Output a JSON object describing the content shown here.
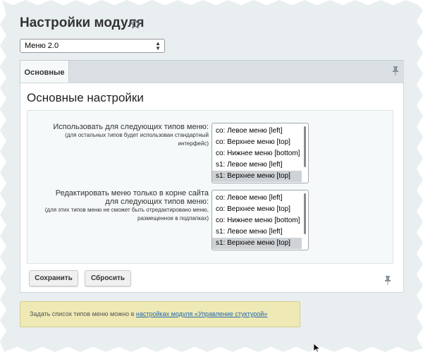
{
  "page": {
    "title": "Настройки модуля"
  },
  "module_select": {
    "value": "Меню 2.0"
  },
  "tabs": [
    {
      "label": "Основные",
      "active": true
    }
  ],
  "section": {
    "title": "Основные настройки"
  },
  "fields": [
    {
      "label": "Использовать для следующих типов меню:",
      "hint": "(для остальных типов будет использован стандартный интерфейс)",
      "options": [
        {
          "label": "co: Левое меню [left]",
          "selected": false
        },
        {
          "label": "co: Верхнее меню [top]",
          "selected": false
        },
        {
          "label": "co: Нижнее меню [bottom]",
          "selected": false
        },
        {
          "label": "s1: Левое меню [left]",
          "selected": false
        },
        {
          "label": "s1: Верхнее меню [top]",
          "selected": true
        }
      ]
    },
    {
      "label": "Редактировать меню только в корне сайта для следующих типов меню:",
      "hint": "(для этих типов меню не сможет быть отредактировано меню, размещенное в подпапках)",
      "options": [
        {
          "label": "co: Левое меню [left]",
          "selected": false
        },
        {
          "label": "co: Верхнее меню [top]",
          "selected": false
        },
        {
          "label": "co: Нижнее меню [bottom]",
          "selected": false
        },
        {
          "label": "s1: Левое меню [left]",
          "selected": false
        },
        {
          "label": "s1: Верхнее меню [top]",
          "selected": true
        }
      ]
    }
  ],
  "buttons": {
    "save": "Сохранить",
    "reset": "Сбросить"
  },
  "hint": {
    "text": "Задать список типов меню можно в ",
    "link": "настройках модуля «Управление стуктурой»"
  },
  "colors": {
    "page_bg": "#e9eef0",
    "hint_bg": "#eee9b5",
    "link": "#2067b0",
    "selected_option": "#cfd3d6"
  },
  "icons": {
    "favorite": "star-icon",
    "pin": "pin-icon",
    "select_arrows": "updown-arrows-icon",
    "cursor": "mouse-cursor-icon"
  }
}
